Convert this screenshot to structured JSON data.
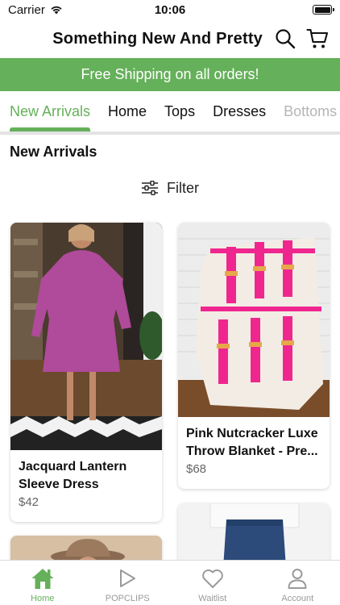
{
  "status_bar": {
    "carrier": "Carrier",
    "time": "10:06"
  },
  "header": {
    "store_title": "Something New And Pretty",
    "search_icon": "search-icon",
    "cart_icon": "cart-icon"
  },
  "banner": {
    "text": "Free Shipping on all orders!",
    "color": "#65b05a"
  },
  "tabs": [
    {
      "label": "New Arrivals",
      "active": true
    },
    {
      "label": "Home"
    },
    {
      "label": "Tops"
    },
    {
      "label": "Dresses"
    },
    {
      "label": "Bottoms"
    }
  ],
  "section": {
    "title": "New Arrivals"
  },
  "filter": {
    "label": "Filter"
  },
  "products": [
    {
      "name": "Jacquard Lantern Sleeve Dress",
      "price": "$42"
    },
    {
      "name": "Pink Nutcracker Luxe Throw Blanket - Pre...",
      "price": "$68"
    },
    {
      "name": "",
      "price": ""
    },
    {
      "name": "",
      "price": ""
    }
  ],
  "bottom_nav": [
    {
      "label": "Home",
      "icon": "home-icon",
      "active": true
    },
    {
      "label": "POPCLIPS",
      "icon": "play-icon"
    },
    {
      "label": "Waitlist",
      "icon": "heart-icon"
    },
    {
      "label": "Account",
      "icon": "account-icon"
    }
  ]
}
